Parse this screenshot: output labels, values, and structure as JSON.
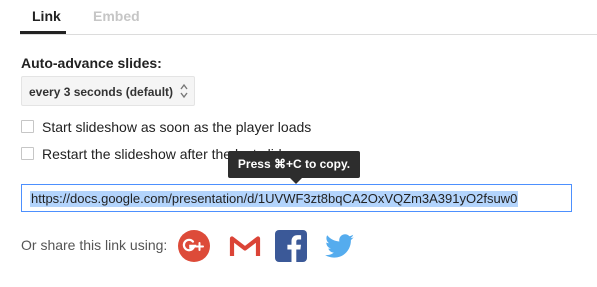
{
  "tabs": [
    {
      "label": "Link",
      "active": true
    },
    {
      "label": "Embed",
      "active": false
    }
  ],
  "auto_advance": {
    "label": "Auto-advance slides:",
    "selected": "every 3 seconds (default)"
  },
  "options": {
    "start_label": "Start slideshow as soon as the player loads",
    "start_checked": false,
    "restart_label": "Restart the slideshow after the last slide",
    "restart_checked": false
  },
  "tooltip": {
    "text": "Press ⌘+C to copy."
  },
  "link": {
    "value": "https://docs.google.com/presentation/d/1UVWF3zt8bqCA2OxVQZm3A391yO2fsuw0"
  },
  "share": {
    "label": "Or share this link using:",
    "icons": [
      "google-plus-icon",
      "gmail-icon",
      "facebook-icon",
      "twitter-icon"
    ]
  },
  "colors": {
    "google_plus": "#dd4b39",
    "gmail": "#db4437",
    "facebook": "#3b5998",
    "twitter": "#55acee",
    "focus_border": "#4d90fe",
    "selection": "#b3d4fc"
  }
}
